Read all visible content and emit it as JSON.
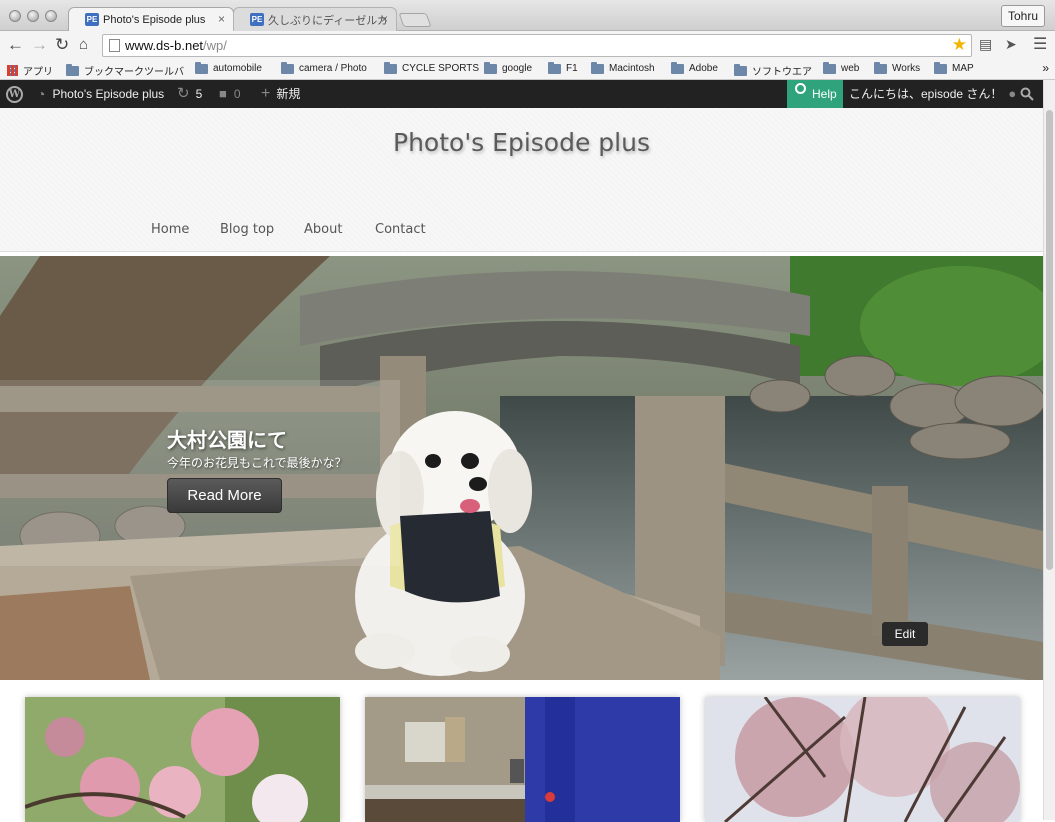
{
  "browser": {
    "tabs": [
      {
        "label": "Photo's Episode plus",
        "favicon": "PE",
        "active": true
      },
      {
        "label": "久しぶりにディーゼルカー",
        "favicon": "PE",
        "active": false
      }
    ],
    "close_glyph": "×",
    "user_profile": "Tohru",
    "url_host": "www.ds-b.net",
    "url_path": "/wp/",
    "bookmarks": [
      "アプリ",
      "ブックマークツールバ",
      "automobile",
      "camera / Photo",
      "CYCLE SPORTS",
      "google",
      "F1",
      "Macintosh",
      "Adobe",
      "ソフトウエア",
      "web",
      "Works",
      "MAP"
    ],
    "bookmarks_more": "»"
  },
  "admin_bar": {
    "site_name": "Photo's Episode plus",
    "updates_count": "5",
    "comments_count": "0",
    "new_label": "新規",
    "help_label": "Help",
    "greeting": "こんにちは、episode さん！"
  },
  "site": {
    "title": "Photo's Episode plus",
    "nav": [
      "Home",
      "Blog top",
      "About",
      "Contact"
    ]
  },
  "hero": {
    "title": "大村公園にて",
    "subtitle": "今年のお花見もこれで最後かな？",
    "read_more": "Read More",
    "edit": "Edit"
  },
  "icons": {
    "back": "back-arrow-icon",
    "forward": "forward-arrow-icon",
    "reload": "reload-icon",
    "home": "home-icon",
    "bookmark_star": "star-icon",
    "menu": "hamburger-menu-icon",
    "wordpress": "wordpress-logo-icon",
    "dashboard": "dashboard-icon",
    "updates": "refresh-icon",
    "comments": "comment-icon",
    "new": "plus-icon",
    "user": "user-icon",
    "search": "search-icon"
  },
  "colors": {
    "admin_bar": "#222222",
    "help_accent": "#2ea37c",
    "star": "#f2b600"
  }
}
